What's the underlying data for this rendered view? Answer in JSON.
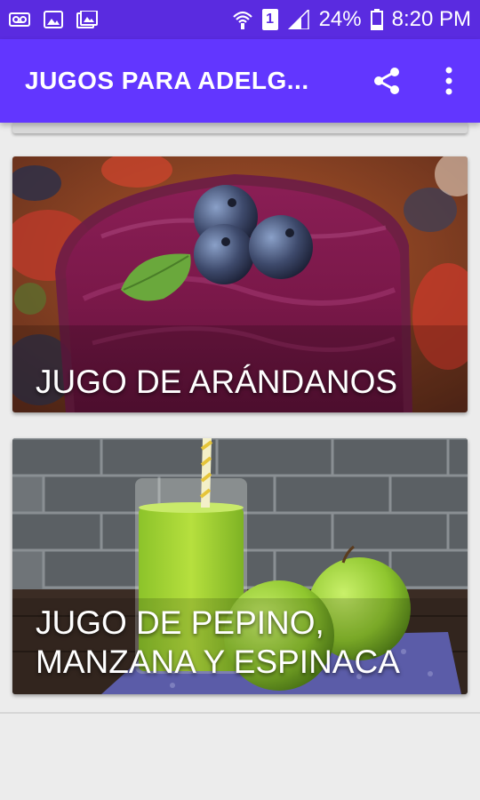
{
  "status_bar": {
    "battery": "24%",
    "time": "8:20 PM",
    "sim": "1",
    "icons": [
      "voicemail-icon",
      "image-icon",
      "gallery-icon",
      "wifi-icon",
      "sim-icon",
      "signal-icon",
      "battery-icon"
    ]
  },
  "app_bar": {
    "title": "JUGOS PARA ADELG...",
    "actions": [
      "share-icon",
      "overflow-menu-icon"
    ]
  },
  "colors": {
    "status_bar": "#5a2be0",
    "app_bar": "#6236ff",
    "background": "#ececec"
  },
  "cards": [
    {
      "title": "JUGO DE ARÁNDANOS",
      "image": "blueberry-smoothie-image"
    },
    {
      "title": "JUGO DE PEPINO, MANZANA Y ESPINACA",
      "image": "green-juice-image"
    }
  ]
}
